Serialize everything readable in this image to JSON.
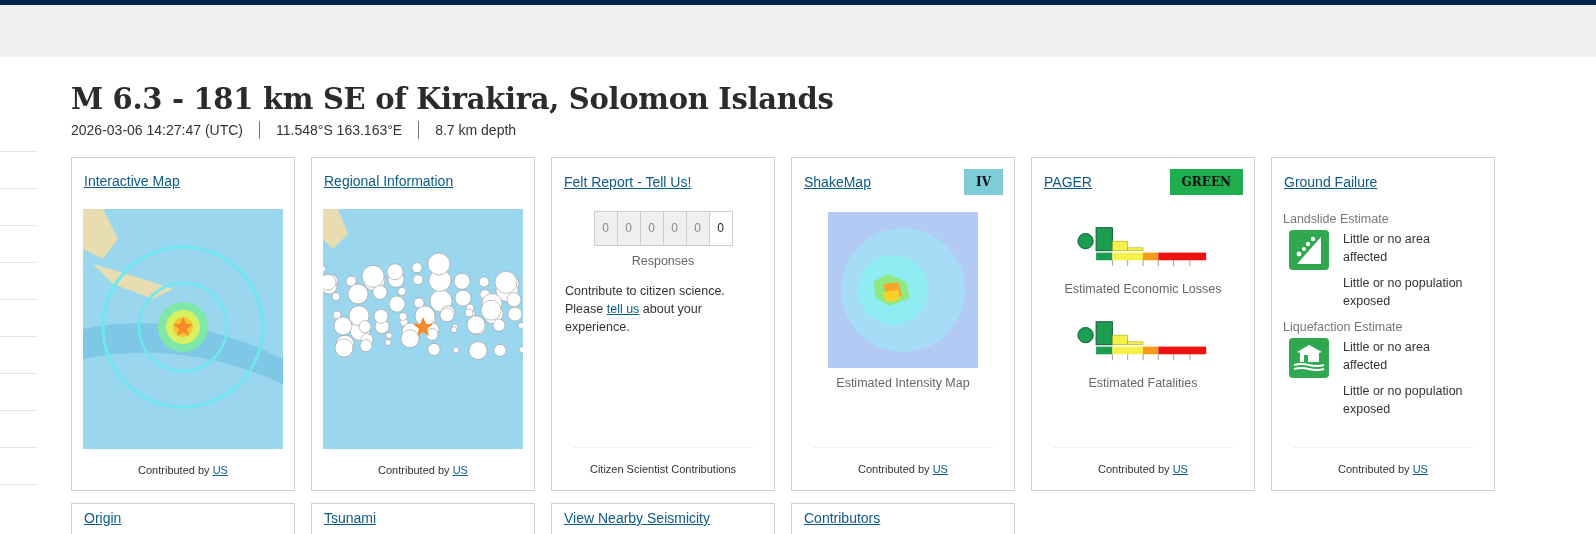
{
  "header": {
    "title": "M 6.3 - 181 km SE of Kirakira, Solomon Islands",
    "meta": [
      "2026-03-06 14:27:47 (UTC)",
      "11.548°S 163.163°E",
      "8.7 km depth"
    ]
  },
  "cards": [
    {
      "kind": "map",
      "title": "Interactive Map",
      "footer": "Contributed by",
      "footer_link": "US"
    },
    {
      "kind": "map",
      "title": "Regional Information",
      "footer": "Contributed by",
      "footer_link": "US"
    },
    {
      "kind": "felt",
      "title": "Felt Report - Tell Us!",
      "digits": [
        {
          "value": "0",
          "active": false
        },
        {
          "value": "0",
          "active": false
        },
        {
          "value": "0",
          "active": false
        },
        {
          "value": "0",
          "active": false
        },
        {
          "value": "0",
          "active": false
        },
        {
          "value": "0",
          "active": true
        }
      ],
      "caption": "Responses",
      "text_before": "Contribute to citizen science. Please",
      "text_link": "tell us",
      "text_after": "about your experience.",
      "footer": "Citizen Scientist Contributions"
    },
    {
      "kind": "shakemap",
      "title": "ShakeMap",
      "badge": {
        "text": "IV",
        "color": "#7fcbd7"
      },
      "caption": "Estimated Intensity Map",
      "footer": "Contributed by",
      "footer_link": "US"
    },
    {
      "kind": "pager",
      "title": "PAGER",
      "badge": {
        "text": "GREEN",
        "color": "#1fae4f"
      },
      "captions": [
        "Estimated Economic Losses",
        "Estimated Fatalities"
      ],
      "footer": "Contributed by",
      "footer_link": "US"
    },
    {
      "kind": "ground",
      "title": "Ground Failure",
      "sections": [
        {
          "title": "Landslide Estimate",
          "lines": [
            "Little or no area affected",
            "Little or no population exposed"
          ]
        },
        {
          "title": "Liquefaction Estimate",
          "lines": [
            "Little or no area affected",
            "Little or no population exposed"
          ]
        }
      ],
      "footer": "Contributed by",
      "footer_link": "US"
    }
  ],
  "more_cards": [
    "Origin",
    "Tsunami",
    "View Nearby Seismicity",
    "Contributors"
  ]
}
